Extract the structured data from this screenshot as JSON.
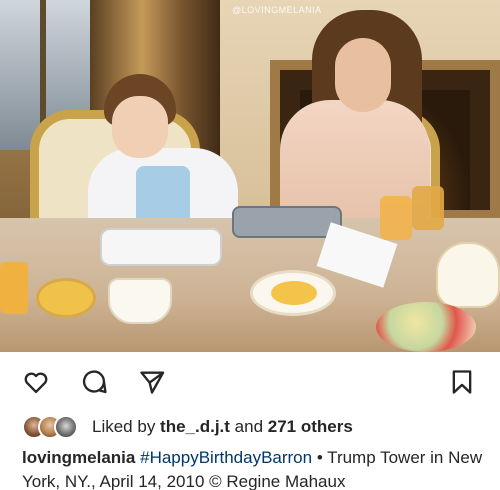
{
  "post": {
    "watermark": "@LOVINGMELANIA"
  },
  "actions": {
    "like_icon": "heart-icon",
    "comment_icon": "comment-icon",
    "share_icon": "share-icon",
    "save_icon": "bookmark-icon"
  },
  "likes": {
    "prefix": "Liked by ",
    "user": "the_.d.j.t",
    "middle": " and ",
    "others": "271 others"
  },
  "caption": {
    "username": "lovingmelania",
    "hashtag": "#HappyBirthdayBarron",
    "text": " • Trump Tower in New York, NY., April 14, 2010 © Regine Mahaux"
  },
  "colors": {
    "hashtag": "#00376b",
    "text": "#262626",
    "background": "#ffffff"
  }
}
